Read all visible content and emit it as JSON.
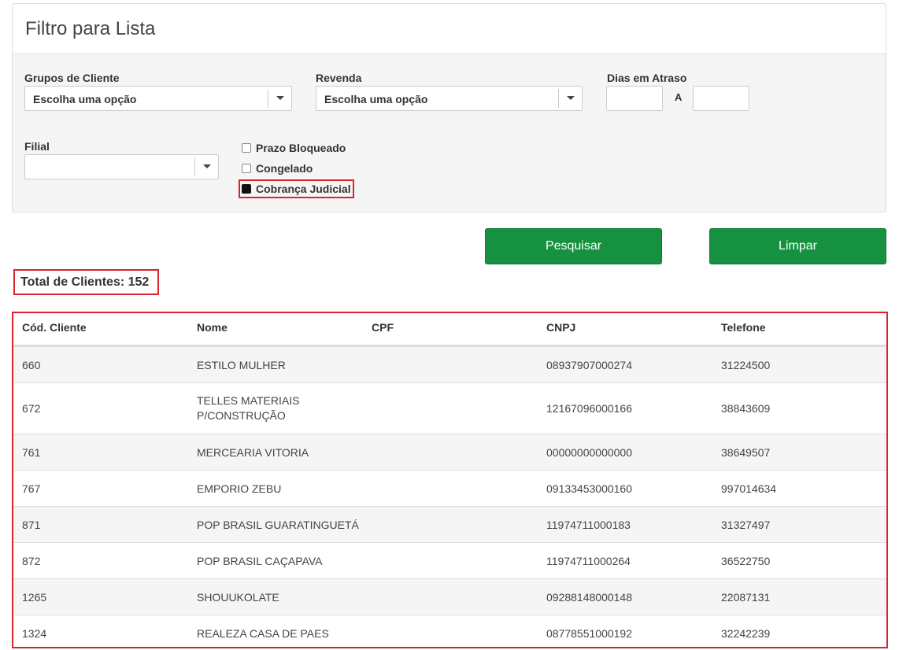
{
  "filter_panel": {
    "title": "Filtro para Lista",
    "grupos_label": "Grupos de Cliente",
    "grupos_value": "Escolha uma opção",
    "revenda_label": "Revenda",
    "revenda_value": "Escolha uma opção",
    "dias_label": "Dias em Atraso",
    "dias_sep": "A",
    "filial_label": "Filial",
    "checkboxes": [
      {
        "label": "Prazo Bloqueado",
        "checked": false
      },
      {
        "label": "Congelado",
        "checked": false
      },
      {
        "label": "Cobrança Judicial",
        "checked": true
      }
    ]
  },
  "buttons": {
    "search": "Pesquisar",
    "clear": "Limpar"
  },
  "total": "Total de Clientes: 152",
  "table": {
    "headers": [
      "Cód. Cliente",
      "Nome",
      "CPF",
      "CNPJ",
      "Telefone"
    ],
    "rows": [
      {
        "cod": "660",
        "nome": "ESTILO MULHER",
        "nome2": "",
        "cpf": "",
        "cnpj": "08937907000274",
        "tel": "31224500"
      },
      {
        "cod": "672",
        "nome": "TELLES MATERIAIS",
        "nome2": "P/CONSTRUÇÃO",
        "cpf": "",
        "cnpj": "12167096000166",
        "tel": "38843609"
      },
      {
        "cod": "761",
        "nome": "MERCEARIA VITORIA",
        "nome2": "",
        "cpf": "",
        "cnpj": "00000000000000",
        "tel": "38649507"
      },
      {
        "cod": "767",
        "nome": "EMPORIO ZEBU",
        "nome2": "",
        "cpf": "",
        "cnpj": "09133453000160",
        "tel": "997014634"
      },
      {
        "cod": "871",
        "nome": "POP BRASIL GUARATINGUETÁ",
        "nome2": "",
        "cpf": "",
        "cnpj": "11974711000183",
        "tel": "31327497"
      },
      {
        "cod": "872",
        "nome": "POP BRASIL CAÇAPAVA",
        "nome2": "",
        "cpf": "",
        "cnpj": "11974711000264",
        "tel": "36522750"
      },
      {
        "cod": "1265",
        "nome": "SHOUUKOLATE",
        "nome2": "",
        "cpf": "",
        "cnpj": "09288148000148",
        "tel": "22087131"
      },
      {
        "cod": "1324",
        "nome": "REALEZA CASA DE PAES",
        "nome2": "",
        "cpf": "",
        "cnpj": "08778551000192",
        "tel": "32242239"
      }
    ]
  },
  "colors": {
    "button_green": "#16913f",
    "highlight_red": "#d9232d"
  }
}
